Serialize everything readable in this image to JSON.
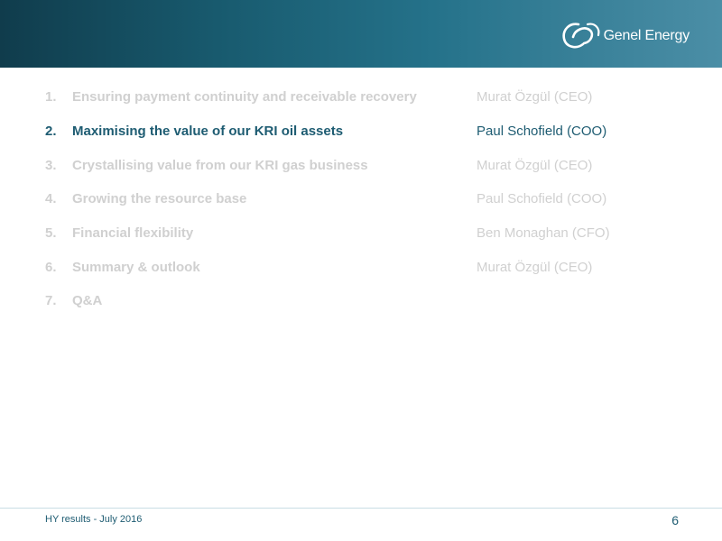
{
  "header": {
    "logo_text": "Genel Energy",
    "background_colors": [
      "#103c4c",
      "#25728a",
      "#4b8ea6"
    ]
  },
  "agenda": {
    "items": [
      {
        "number": "1.",
        "topic": "Ensuring payment continuity and receivable recovery",
        "presenter": "Murat Özgül (CEO)",
        "active": false
      },
      {
        "number": "2.",
        "topic": "Maximising the value of our KRI oil assets",
        "presenter": "Paul Schofield (COO)",
        "active": true
      },
      {
        "number": "3.",
        "topic": "Crystallising value from our KRI gas business",
        "presenter": "Murat Özgül (CEO)",
        "active": false
      },
      {
        "number": "4.",
        "topic": "Growing the resource base",
        "presenter": "Paul Schofield (COO)",
        "active": false
      },
      {
        "number": "5.",
        "topic": "Financial flexibility",
        "presenter": "Ben Monaghan (CFO)",
        "active": false
      },
      {
        "number": "6.",
        "topic": "Summary & outlook",
        "presenter": "Murat Özgül (CEO)",
        "active": false
      },
      {
        "number": "7.",
        "topic": "Q&A",
        "presenter": "",
        "active": false
      }
    ],
    "active_color": "#1e5c72",
    "inactive_color": "#d0d0d0"
  },
  "footer": {
    "text": "HY results - July 2016",
    "page_number": "6"
  }
}
